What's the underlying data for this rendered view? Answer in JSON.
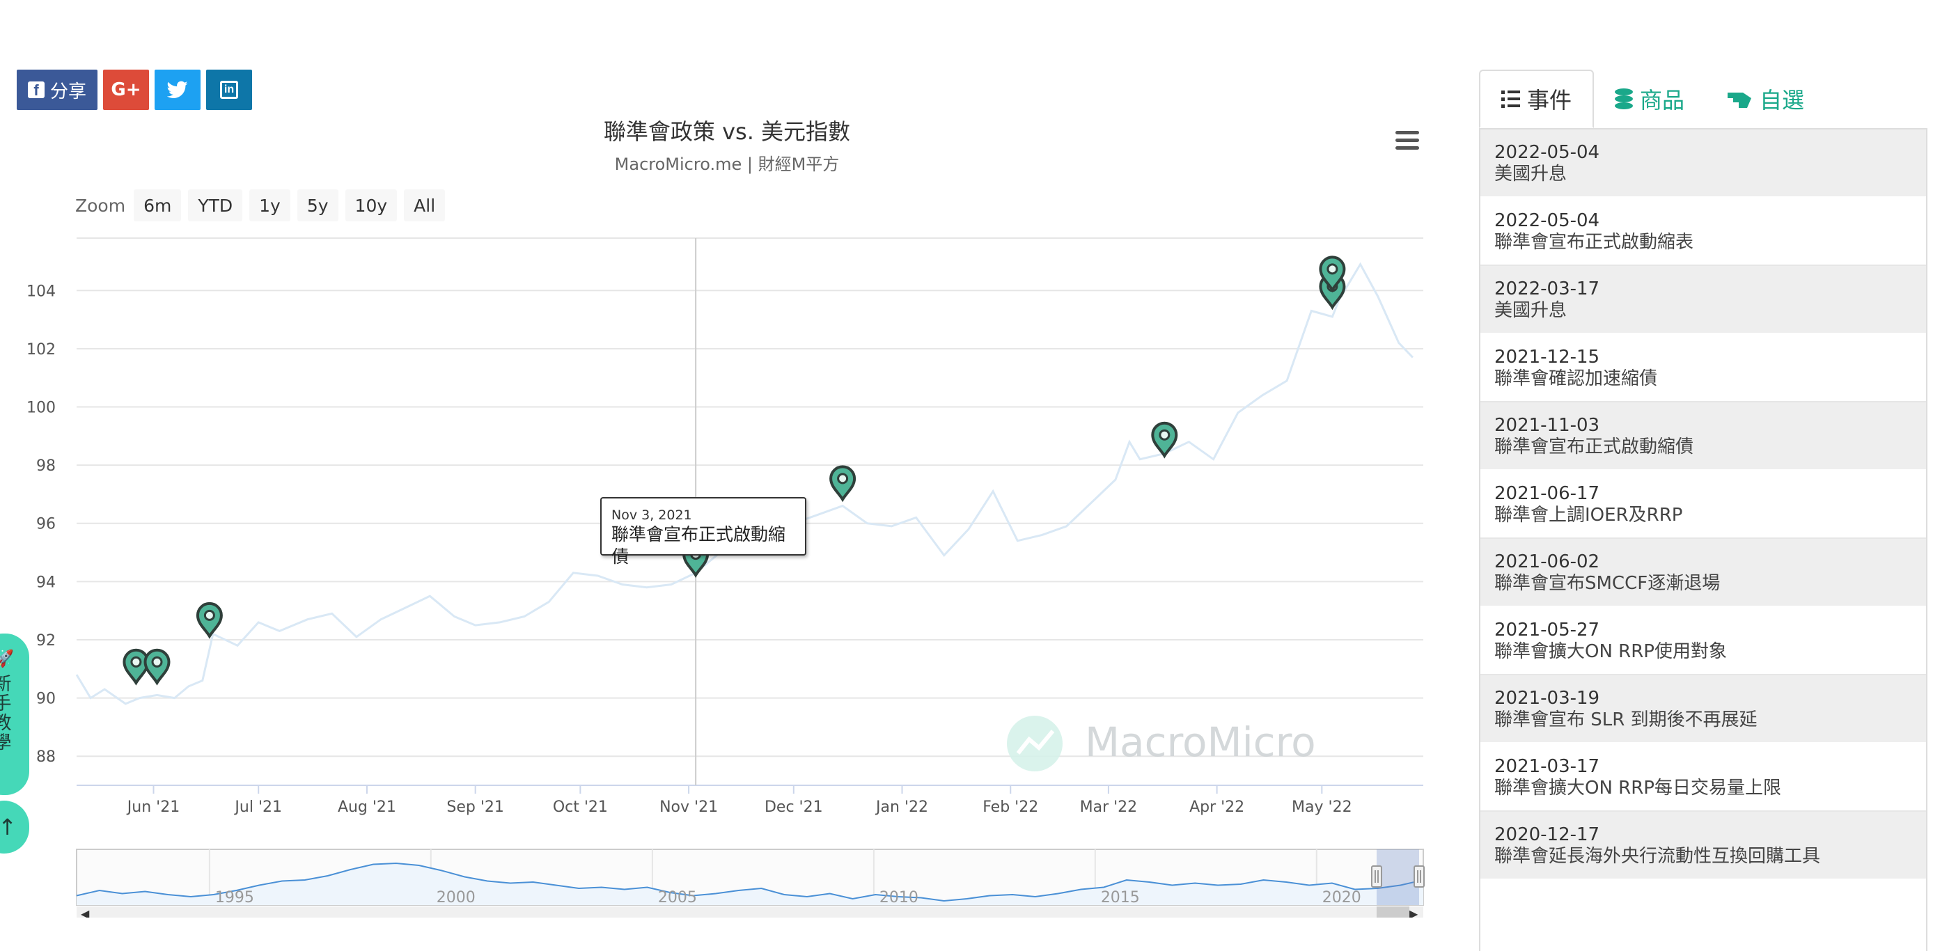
{
  "share": {
    "facebook_label": "分享",
    "googleplus_label": "G+"
  },
  "chart_data": {
    "type": "line",
    "title": "聯準會政策 vs. 美元指數",
    "subtitle": "MacroMicro.me | 財經M平方",
    "watermark": "MacroMicro",
    "xlabel": "",
    "ylabel": "",
    "x_tick_labels": [
      "Jun '21",
      "Jul '21",
      "Aug '21",
      "Sep '21",
      "Oct '21",
      "Nov '21",
      "Dec '21",
      "Jan '22",
      "Feb '22",
      "Mar '22",
      "Apr '22",
      "May '22"
    ],
    "y_ticks": [
      88,
      90,
      92,
      94,
      96,
      98,
      100,
      102,
      104
    ],
    "xlim": [
      "2021-05-10",
      "2022-05-30"
    ],
    "ylim": [
      87,
      105.8
    ],
    "grid": true,
    "series": [
      {
        "x": [
          "2021-05-10",
          "2021-05-14",
          "2021-05-18",
          "2021-05-24",
          "2021-05-28",
          "2021-06-02",
          "2021-06-07",
          "2021-06-11",
          "2021-06-15",
          "2021-06-18",
          "2021-06-25",
          "2021-07-01",
          "2021-07-07",
          "2021-07-15",
          "2021-07-22",
          "2021-07-29",
          "2021-08-05",
          "2021-08-12",
          "2021-08-19",
          "2021-08-26",
          "2021-09-01",
          "2021-09-08",
          "2021-09-15",
          "2021-09-22",
          "2021-09-29",
          "2021-10-06",
          "2021-10-13",
          "2021-10-20",
          "2021-10-27",
          "2021-11-03",
          "2021-11-10",
          "2021-11-17",
          "2021-11-24",
          "2021-12-01",
          "2021-12-08",
          "2021-12-15",
          "2021-12-22",
          "2021-12-29",
          "2022-01-05",
          "2022-01-13",
          "2022-01-20",
          "2022-01-27",
          "2022-02-03",
          "2022-02-10",
          "2022-02-17",
          "2022-02-24",
          "2022-03-03",
          "2022-03-07",
          "2022-03-10",
          "2022-03-17",
          "2022-03-24",
          "2022-03-31",
          "2022-04-07",
          "2022-04-14",
          "2022-04-21",
          "2022-04-28",
          "2022-05-04",
          "2022-05-06",
          "2022-05-12",
          "2022-05-17",
          "2022-05-23",
          "2022-05-27"
        ],
        "values": [
          90.8,
          90.0,
          90.3,
          89.8,
          90.0,
          90.1,
          90.0,
          90.4,
          90.6,
          92.2,
          91.8,
          92.6,
          92.3,
          92.7,
          92.9,
          92.1,
          92.7,
          93.1,
          93.5,
          92.8,
          92.5,
          92.6,
          92.8,
          93.3,
          94.3,
          94.2,
          93.9,
          93.8,
          93.9,
          94.3,
          95.0,
          95.8,
          96.6,
          96.0,
          96.3,
          96.6,
          96.0,
          95.9,
          96.2,
          94.9,
          95.8,
          97.1,
          95.4,
          95.6,
          95.9,
          96.7,
          97.5,
          98.8,
          98.2,
          98.4,
          98.8,
          98.2,
          99.8,
          100.4,
          100.9,
          103.3,
          103.1,
          103.7,
          104.9,
          103.8,
          102.2,
          101.7
        ],
        "color": "#d9e8f5"
      }
    ],
    "event_markers": [
      {
        "date": "2021-05-27",
        "value": 91.0
      },
      {
        "date": "2021-06-02",
        "value": 91.0
      },
      {
        "date": "2021-06-17",
        "value": 92.6
      },
      {
        "date": "2021-11-03",
        "value": 94.7
      },
      {
        "date": "2021-12-15",
        "value": 97.3
      },
      {
        "date": "2022-03-17",
        "value": 98.8
      },
      {
        "date": "2022-05-04",
        "value": 103.9
      },
      {
        "date": "2022-05-04",
        "value": 104.5
      }
    ],
    "crosshair_date": "2021-11-03",
    "navigator": {
      "x_tick_labels": [
        "1995",
        "2000",
        "2005",
        "2010",
        "2015",
        "2020"
      ],
      "xlim": [
        "1992-01-01",
        "2022-05-30"
      ],
      "selected_range": [
        "2021-05-10",
        "2022-05-30"
      ],
      "values": [
        85,
        90,
        87,
        89,
        86,
        84,
        86,
        90,
        95,
        99,
        100,
        104,
        110,
        115,
        116,
        114,
        109,
        103,
        99,
        97,
        98,
        95,
        92,
        93,
        91,
        93,
        88,
        85,
        87,
        90,
        92,
        86,
        84,
        87,
        82,
        86,
        84,
        83,
        80,
        82,
        85,
        86,
        84,
        87,
        91,
        93,
        100,
        98,
        95,
        97,
        95,
        96,
        100,
        98,
        95,
        97,
        91,
        92,
        95,
        100
      ]
    }
  },
  "zoom": {
    "label": "Zoom",
    "buttons": [
      "6m",
      "YTD",
      "1y",
      "5y",
      "10y",
      "All"
    ]
  },
  "tooltip": {
    "date": "Nov 3, 2021",
    "text": "聯準會宣布正式啟動縮債"
  },
  "tutorial": {
    "label": "新手教學"
  },
  "panel": {
    "tabs": [
      {
        "label": "事件"
      },
      {
        "label": "商品"
      },
      {
        "label": "自選"
      }
    ],
    "events": [
      {
        "date": "2022-05-04",
        "text": "美國升息"
      },
      {
        "date": "2022-05-04",
        "text": "聯準會宣布正式啟動縮表"
      },
      {
        "date": "2022-03-17",
        "text": "美國升息"
      },
      {
        "date": "2021-12-15",
        "text": "聯準會確認加速縮債"
      },
      {
        "date": "2021-11-03",
        "text": "聯準會宣布正式啟動縮債"
      },
      {
        "date": "2021-06-17",
        "text": "聯準會上調IOER及RRP"
      },
      {
        "date": "2021-06-02",
        "text": "聯準會宣布SMCCF逐漸退場"
      },
      {
        "date": "2021-05-27",
        "text": "聯準會擴大ON RRP使用對象"
      },
      {
        "date": "2021-03-19",
        "text": "聯準會宣布 SLR 到期後不再展延"
      },
      {
        "date": "2021-03-17",
        "text": "聯準會擴大ON RRP每日交易量上限"
      },
      {
        "date": "2020-12-17",
        "text": "聯準會延長海外央行流動性互換回購工具"
      }
    ]
  },
  "colors": {
    "line": "#d9e8f5",
    "navigator_line": "#4a90d6",
    "marker_fill": "#4fb497",
    "marker_stroke": "#2f3f3a",
    "accent_green": "#1aa88a",
    "tutorial_bg": "#45d8b8"
  }
}
